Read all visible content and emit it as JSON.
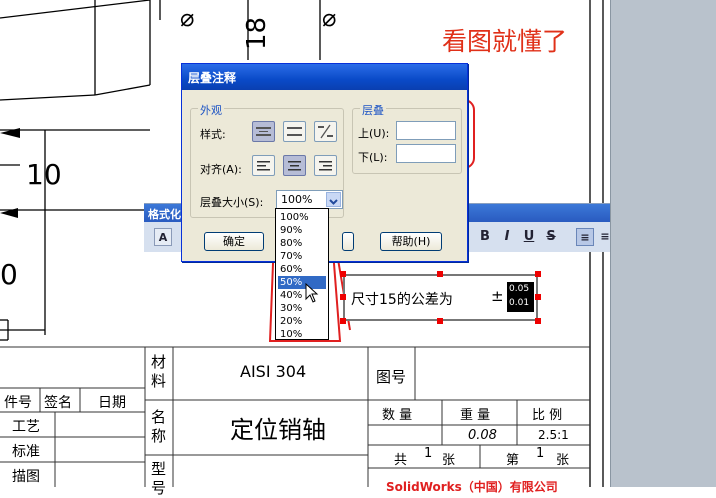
{
  "annotation_caption": "看图就懂了",
  "drawing": {
    "dim_10": "10",
    "dim_18": "18",
    "dim_zero": "0",
    "phi_symbol": "⌀"
  },
  "title_block": {
    "material_label": "材料",
    "material_value": "AISI 304",
    "name_label": "名称",
    "name_value": "定位销轴",
    "type_label": "型号",
    "drawing_no_label": "图号",
    "part_no_label": "件号",
    "sign_label": "签名",
    "date_label": "日期",
    "process_label": "工艺",
    "standard_label": "标准",
    "draw_label": "描图",
    "qty_label": "数 量",
    "weight_label": "重 量",
    "scale_label": "比 例",
    "weight_value": "0.08",
    "scale_value": "2.5:1",
    "total_label": "共",
    "total_value": "1",
    "sheet_unit": "张",
    "sheet_label": "第",
    "sheet_value": "1",
    "company_partial": "SolidWorks（中国）有限公司"
  },
  "format_toolbar": {
    "title": "格式化",
    "bold": "B",
    "italic": "I",
    "underline": "U",
    "strike": "S"
  },
  "dialog": {
    "title": "层叠注释",
    "appearance_group": "外观",
    "style_label": "样式:",
    "align_label": "对齐(A):",
    "stack_size_label": "层叠大小(S):",
    "stack_size_value": "100%",
    "stack_group": "层叠",
    "upper_label": "上(U):",
    "lower_label": "下(L):",
    "upper_value": "",
    "lower_value": "",
    "ok_label": "确定",
    "help_label": "帮助(H)",
    "icons": {
      "style1": "stack-horizontal-icon",
      "style2": "stack-nobar-icon",
      "style3": "stack-diagonal-icon"
    }
  },
  "dropdown_options": [
    "100%",
    "90%",
    "80%",
    "70%",
    "60%",
    "50%",
    "40%",
    "30%",
    "20%",
    "10%"
  ],
  "dropdown_selected": "50%",
  "note": {
    "text": "尺寸15的公差为",
    "plusminus": "±",
    "upper_tol": "0.05",
    "lower_tol": "0.01"
  },
  "colors": {
    "highlight_red": "#e02020",
    "titlebar_blue": "#0a4ac8",
    "selection_blue": "#316ac5"
  }
}
